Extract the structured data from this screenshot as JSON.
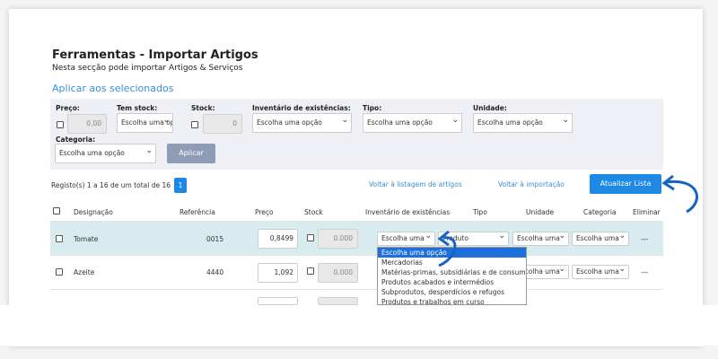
{
  "header": {
    "title": "Ferramentas - Importar Artigos",
    "subtitle": "Nesta secção pode importar Artigos & Serviços"
  },
  "bulk": {
    "title": "Aplicar aos selecionados",
    "preco_label": "Preço:",
    "preco_value": "0,00",
    "tem_stock_label": "Tem stock:",
    "tem_stock_value": "Escolha uma opção",
    "stock_label": "Stock:",
    "stock_value": "0",
    "inventario_label": "Inventário de existências:",
    "inventario_value": "Escolha uma opção",
    "tipo_label": "Tipo:",
    "tipo_value": "Escolha uma opção",
    "unidade_label": "Unidade:",
    "unidade_value": "Escolha uma opção",
    "categoria_label": "Categoria:",
    "categoria_value": "Escolha uma opção",
    "apply_label": "Aplicar"
  },
  "pagination": {
    "info": "Registo(s) 1 a 16 de um total de 16",
    "page": "1"
  },
  "links": {
    "back_list": "Voltar à listagem de artigos",
    "back_import": "Voltar à importação",
    "refresh": "Atualizar Lista"
  },
  "table": {
    "headers": [
      "Designação",
      "Referência",
      "Preço",
      "Stock",
      "Inventário de existências",
      "Tipo",
      "Unidade",
      "Categoria",
      "Eliminar"
    ],
    "rows": [
      {
        "name": "Tomate",
        "ref": "0015",
        "price": "0,8499",
        "stock": "0.000",
        "inventario": "Escolha uma",
        "tipo": "Produto",
        "unidade": "Escolha uma",
        "categoria": "Escolha uma",
        "delete": "---"
      },
      {
        "name": "Azeite",
        "ref": "4440",
        "price": "1,092",
        "stock": "0.000",
        "inventario": "",
        "tipo": "",
        "unidade": "Escolha uma",
        "categoria": "Escolha uma",
        "delete": "---"
      }
    ]
  },
  "dropdown": {
    "options": [
      "Escolha uma opção",
      "Mercadorias",
      "Matérias-primas, subsidiárias e de consumo",
      "Produtos acabados e intermédios",
      "Subprodutos, desperdícios e refugos",
      "Produtos e trabalhos em curso"
    ]
  },
  "colors": {
    "accent": "#1e88e5",
    "link": "#3a8ed6",
    "row_highlight": "#d8ebee",
    "arrow": "#1565c0"
  }
}
